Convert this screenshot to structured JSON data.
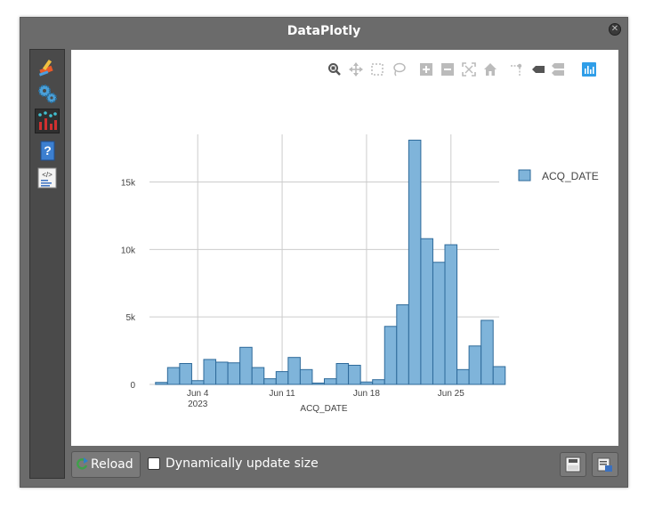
{
  "window": {
    "title": "DataPlotly"
  },
  "sidebar": {
    "items": [
      {
        "name": "properties",
        "icon": "paintbrush-icon"
      },
      {
        "name": "settings",
        "icon": "gears-icon"
      },
      {
        "name": "plot",
        "icon": "chart-icon"
      },
      {
        "name": "help",
        "icon": "help-icon"
      },
      {
        "name": "code",
        "icon": "code-icon"
      }
    ]
  },
  "modebar": {
    "icons": [
      "zoom-icon",
      "pan-icon",
      "box-select-icon",
      "lasso-select-icon",
      "zoom-in-icon",
      "zoom-out-icon",
      "autoscale-icon",
      "reset-axes-icon",
      "spike-lines-icon",
      "hover-closest-icon",
      "hover-compare-icon",
      "plotly-logo-icon"
    ]
  },
  "chart_data": {
    "type": "bar",
    "x_axis": {
      "label": "ACQ_DATE",
      "ticks": [
        "Jun 4",
        "Jun 11",
        "Jun 18",
        "Jun 25"
      ],
      "year_label": "2023",
      "range": [
        "2023-05-31",
        "2023-06-29"
      ]
    },
    "y_axis": {
      "ticks": [
        "0",
        "5k",
        "10k",
        "15k"
      ],
      "range": [
        0,
        18200
      ]
    },
    "grid": true,
    "legend": {
      "placement": "top-right"
    },
    "series": [
      {
        "name": "ACQ_DATE",
        "color": "#7fb4da",
        "edge_color": "#2e6a9a",
        "x": [
          "2023-06-01",
          "2023-06-02",
          "2023-06-03",
          "2023-06-04",
          "2023-06-05",
          "2023-06-06",
          "2023-06-07",
          "2023-06-08",
          "2023-06-09",
          "2023-06-10",
          "2023-06-11",
          "2023-06-12",
          "2023-06-13",
          "2023-06-14",
          "2023-06-15",
          "2023-06-16",
          "2023-06-17",
          "2023-06-18",
          "2023-06-19",
          "2023-06-20",
          "2023-06-21",
          "2023-06-22",
          "2023-06-23",
          "2023-06-24",
          "2023-06-25",
          "2023-06-26",
          "2023-06-27",
          "2023-06-28",
          "2023-06-29"
        ],
        "values": [
          150,
          1250,
          1550,
          280,
          1850,
          1650,
          1600,
          2750,
          1250,
          420,
          950,
          2000,
          1100,
          100,
          420,
          1550,
          1420,
          180,
          350,
          4300,
          5900,
          18100,
          10800,
          9050,
          10350,
          1100,
          2850,
          4750,
          1320
        ]
      }
    ]
  },
  "bottom": {
    "reload_label": "Reload",
    "dynamic_label": "Dynamically update size",
    "dynamic_checked": false
  }
}
